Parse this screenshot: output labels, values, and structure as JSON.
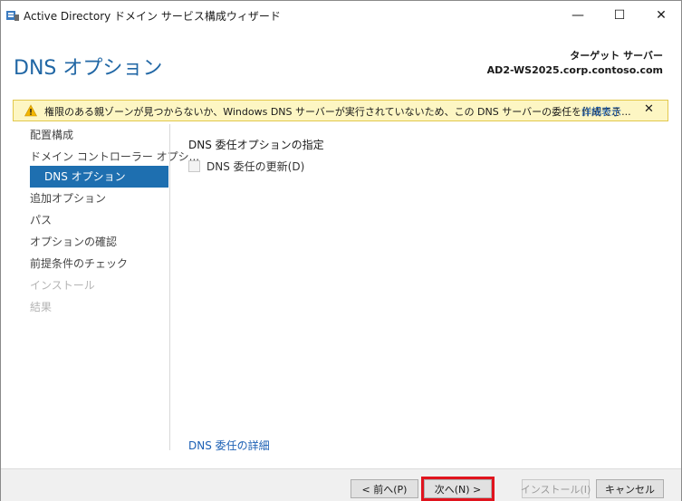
{
  "window": {
    "title": "Active Directory ドメイン サービス構成ウィザード",
    "minimize_glyph": "—",
    "maximize_glyph": "☐",
    "close_glyph": "✕"
  },
  "header": {
    "page_title": "DNS オプション",
    "target_label": "ターゲット サーバー",
    "target_server": "AD2-WS2025.corp.contoso.com"
  },
  "warning": {
    "text": "権限のある親ゾーンが見つからないか、Windows DNS サーバーが実行されていないため、この DNS サーバーの委任を作成でき...",
    "link": "詳細表示",
    "close_glyph": "✕",
    "icon": "warning-icon",
    "color_bg": "#fdf6c3",
    "color_border": "#e2c84d"
  },
  "nav": {
    "items": [
      {
        "label": "配置構成",
        "state": "normal"
      },
      {
        "label": "ドメイン コントローラー オプシ...",
        "state": "normal"
      },
      {
        "label": "DNS オプション",
        "state": "active"
      },
      {
        "label": "追加オプション",
        "state": "normal"
      },
      {
        "label": "パス",
        "state": "normal"
      },
      {
        "label": "オプションの確認",
        "state": "normal"
      },
      {
        "label": "前提条件のチェック",
        "state": "normal"
      },
      {
        "label": "インストール",
        "state": "disabled"
      },
      {
        "label": "結果",
        "state": "disabled"
      }
    ],
    "active_color": "#1e6fb0"
  },
  "content": {
    "heading": "DNS 委任オプションの指定",
    "checkbox_label": "DNS 委任の更新(D)",
    "checkbox_checked": false,
    "details_link": "DNS 委任の詳細"
  },
  "footer": {
    "prev_label": "< 前へ(P)",
    "next_label": "次へ(N) >",
    "install_label": "インストール(I)",
    "cancel_label": "キャンセル",
    "highlight_color": "#e0141e"
  },
  "colors": {
    "title_blue": "#2167a5",
    "link_blue": "#1a5fb4"
  }
}
